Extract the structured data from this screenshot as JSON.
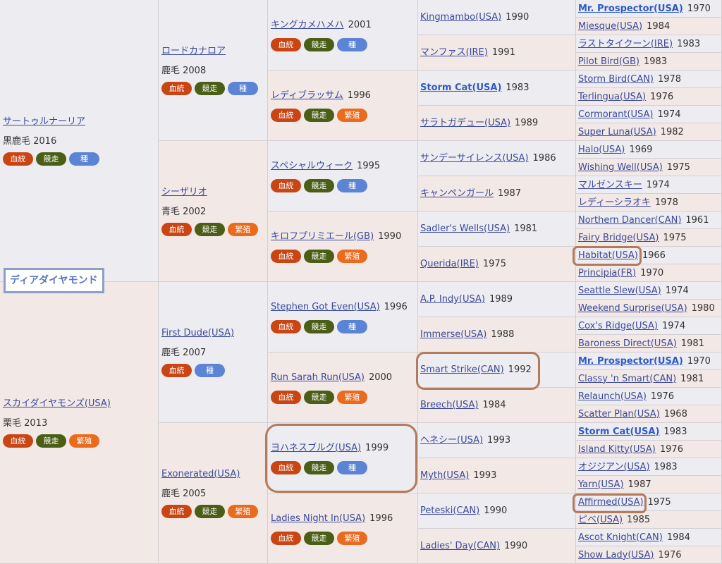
{
  "page": {
    "title": "ディアダイヤモンド",
    "badges": {
      "bloodline": "血統",
      "racing": "競走",
      "stud": "種",
      "breeding": "繁殖"
    }
  },
  "sire": {
    "name": "サートゥルナーリア",
    "meta": "黒鹿毛 2016"
  },
  "dam": {
    "name": "スカイダイヤモンズ(USA)",
    "meta": "栗毛 2013"
  },
  "gen2": [
    {
      "name": "ロードカナロア",
      "meta": "鹿毛 2008"
    },
    {
      "name": "シーザリオ",
      "meta": "青毛 2002"
    },
    {
      "name": "First Dude(USA)",
      "meta": "鹿毛 2007"
    },
    {
      "name": "Exonerated(USA)",
      "meta": "鹿毛 2005"
    }
  ],
  "gen3": [
    {
      "name": "キングカメハメハ",
      "year": "2001"
    },
    {
      "name": "レディブラッサム",
      "year": "1996"
    },
    {
      "name": "スペシャルウィーク",
      "year": "1995"
    },
    {
      "name": "キロフプリミエール(GB)",
      "year": "1990"
    },
    {
      "name": "Stephen Got Even(USA)",
      "year": "1996"
    },
    {
      "name": "Run Sarah Run(USA)",
      "year": "2000"
    },
    {
      "name": "ヨハネスブルグ(USA)",
      "year": "1999"
    },
    {
      "name": "Ladies Night In(USA)",
      "year": "1996"
    }
  ],
  "gen4": [
    {
      "name": "Kingmambo(USA)",
      "year": "1990"
    },
    {
      "name": "マンファス(IRE)",
      "year": "1991"
    },
    {
      "name": "Storm Cat(USA)",
      "year": "1983"
    },
    {
      "name": "サラトガデュー(USA)",
      "year": "1989"
    },
    {
      "name": "サンデーサイレンス(USA)",
      "year": "1986"
    },
    {
      "name": "キャンペンガール",
      "year": "1987"
    },
    {
      "name": "Sadler's Wells(USA)",
      "year": "1981"
    },
    {
      "name": "Querida(IRE)",
      "year": "1975"
    },
    {
      "name": "A.P. Indy(USA)",
      "year": "1989"
    },
    {
      "name": "Immerse(USA)",
      "year": "1988"
    },
    {
      "name": "Smart Strike(CAN)",
      "year": "1992"
    },
    {
      "name": "Breech(USA)",
      "year": "1984"
    },
    {
      "name": "ヘネシー(USA)",
      "year": "1993"
    },
    {
      "name": "Myth(USA)",
      "year": "1993"
    },
    {
      "name": "Peteski(CAN)",
      "year": "1990"
    },
    {
      "name": "Ladies' Day(CAN)",
      "year": "1990"
    }
  ],
  "gen5": [
    {
      "name": "Mr. Prospector(USA)",
      "year": "1970"
    },
    {
      "name": "Miesque(USA)",
      "year": "1984"
    },
    {
      "name": "ラストタイクーン(IRE)",
      "year": "1983"
    },
    {
      "name": "Pilot Bird(GB)",
      "year": "1983"
    },
    {
      "name": "Storm Bird(CAN)",
      "year": "1978"
    },
    {
      "name": "Terlingua(USA)",
      "year": "1976"
    },
    {
      "name": "Cormorant(USA)",
      "year": "1974"
    },
    {
      "name": "Super Luna(USA)",
      "year": "1982"
    },
    {
      "name": "Halo(USA)",
      "year": "1969"
    },
    {
      "name": "Wishing Well(USA)",
      "year": "1975"
    },
    {
      "name": "マルゼンスキー",
      "year": "1974"
    },
    {
      "name": "レディーシラオキ",
      "year": "1978"
    },
    {
      "name": "Northern Dancer(CAN)",
      "year": "1961"
    },
    {
      "name": "Fairy Bridge(USA)",
      "year": "1975"
    },
    {
      "name": "Habitat(USA)",
      "year": "1966"
    },
    {
      "name": "Principia(FR)",
      "year": "1970"
    },
    {
      "name": "Seattle Slew(USA)",
      "year": "1974"
    },
    {
      "name": "Weekend Surprise(USA)",
      "year": "1980"
    },
    {
      "name": "Cox's Ridge(USA)",
      "year": "1974"
    },
    {
      "name": "Baroness Direct(USA)",
      "year": "1981"
    },
    {
      "name": "Mr. Prospector(USA)",
      "year": "1970"
    },
    {
      "name": "Classy 'n Smart(CAN)",
      "year": "1981"
    },
    {
      "name": "Relaunch(USA)",
      "year": "1976"
    },
    {
      "name": "Scatter Plan(USA)",
      "year": "1968"
    },
    {
      "name": "Storm Cat(USA)",
      "year": "1983"
    },
    {
      "name": "Island Kitty(USA)",
      "year": "1976"
    },
    {
      "name": "オジジアン(USA)",
      "year": "1983"
    },
    {
      "name": "Yarn(USA)",
      "year": "1987"
    },
    {
      "name": "Affirmed(USA)",
      "year": "1975"
    },
    {
      "name": "ピベ(USA)",
      "year": "1985"
    },
    {
      "name": "Ascot Knight(CAN)",
      "year": "1984"
    },
    {
      "name": "Show Lady(USA)",
      "year": "1976"
    }
  ],
  "colors": {
    "male_bg": "#edecf1",
    "female_bg": "#f2e8e6",
    "link": "#3a4a99",
    "badge_bloodline": "#c94514",
    "badge_racing": "#4a5e16",
    "badge_stud": "#5b84d5",
    "badge_breeding": "#ea6a1e",
    "highlight_ring": "#b57a5a"
  }
}
